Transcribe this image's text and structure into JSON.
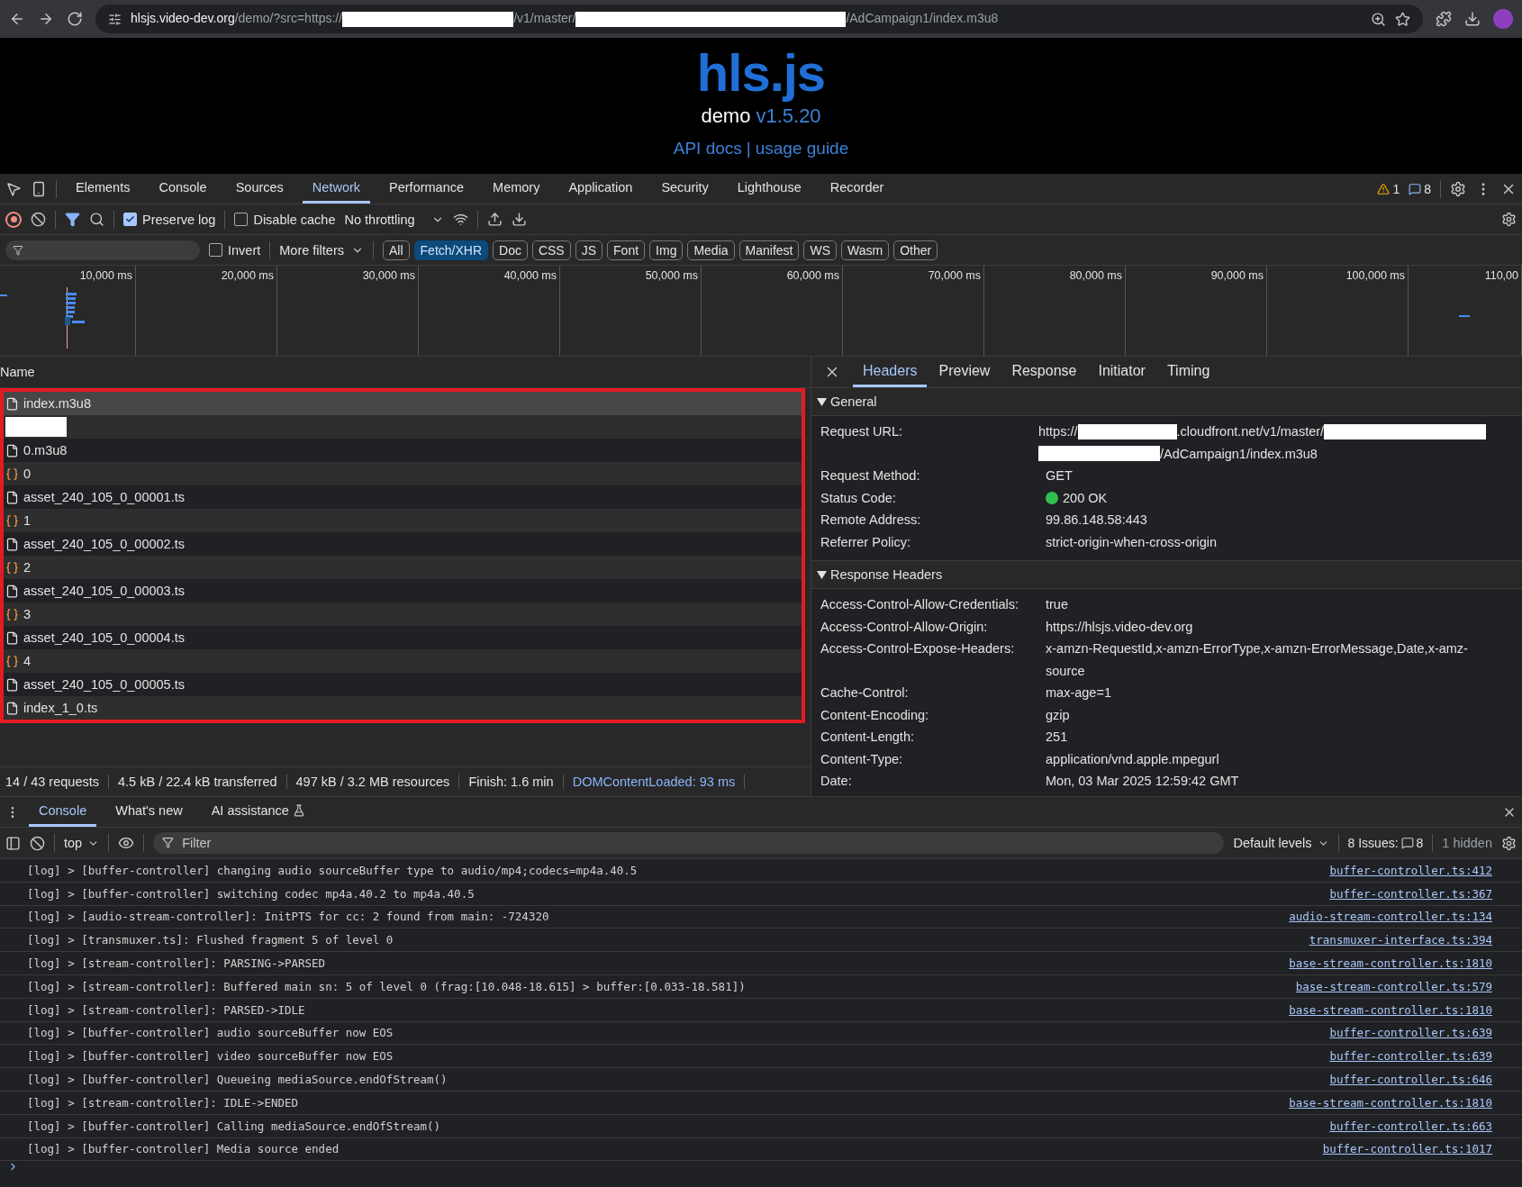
{
  "browser": {
    "url": [
      {
        "kind": "host",
        "text": "hlsjs.video-dev.org"
      },
      {
        "kind": "path",
        "text": "/demo/?src=https://"
      },
      {
        "kind": "redacted"
      },
      {
        "kind": "path",
        "text": "/v1/master/"
      },
      {
        "kind": "redacted"
      },
      {
        "kind": "path",
        "text": "/AdCampaign1/index.m3u8"
      }
    ]
  },
  "page": {
    "logo": "hls.js",
    "demo_label": "demo",
    "version": "v1.5.20",
    "links": [
      "API docs",
      "usage guide"
    ],
    "separator": "|"
  },
  "devtools": {
    "tabs": [
      {
        "label": "Elements",
        "selected": false
      },
      {
        "label": "Console",
        "selected": false
      },
      {
        "label": "Sources",
        "selected": false
      },
      {
        "label": "Network",
        "selected": true
      },
      {
        "label": "Performance",
        "selected": false
      },
      {
        "label": "Memory",
        "selected": false
      },
      {
        "label": "Application",
        "selected": false
      },
      {
        "label": "Security",
        "selected": false
      },
      {
        "label": "Lighthouse",
        "selected": false
      },
      {
        "label": "Recorder",
        "selected": false
      }
    ],
    "warnings": "1",
    "messages": "8"
  },
  "network_toolbar": {
    "recording": true,
    "preserve_log": {
      "label": "Preserve log",
      "checked": true
    },
    "disable_cache": {
      "label": "Disable cache",
      "checked": false
    },
    "throttling": "No throttling"
  },
  "filter_bar": {
    "invert": {
      "label": "Invert",
      "checked": false
    },
    "more_filters": "More filters",
    "types": [
      {
        "label": "All",
        "selected": false
      },
      {
        "label": "Fetch/XHR",
        "selected": true
      },
      {
        "label": "Doc",
        "selected": false
      },
      {
        "label": "CSS",
        "selected": false
      },
      {
        "label": "JS",
        "selected": false
      },
      {
        "label": "Font",
        "selected": false
      },
      {
        "label": "Img",
        "selected": false
      },
      {
        "label": "Media",
        "selected": false
      },
      {
        "label": "Manifest",
        "selected": false
      },
      {
        "label": "WS",
        "selected": false
      },
      {
        "label": "Wasm",
        "selected": false
      },
      {
        "label": "Other",
        "selected": false
      }
    ]
  },
  "timeline": {
    "ticks": [
      "10,000 ms",
      "20,000 ms",
      "30,000 ms",
      "40,000 ms",
      "50,000 ms",
      "60,000 ms",
      "70,000 ms",
      "80,000 ms",
      "90,000 ms",
      "100,000 ms",
      "110,00"
    ]
  },
  "requests": {
    "header": "Name",
    "rows": [
      {
        "kind": "doc",
        "name": "index.m3u8",
        "selected": true
      },
      {
        "kind": "redacted",
        "selected": false
      },
      {
        "kind": "doc",
        "name": "0.m3u8",
        "selected": false
      },
      {
        "kind": "xhr",
        "name": "0",
        "selected": false
      },
      {
        "kind": "doc",
        "name": "asset_240_105_0_00001.ts",
        "selected": false
      },
      {
        "kind": "xhr",
        "name": "1",
        "selected": false
      },
      {
        "kind": "doc",
        "name": "asset_240_105_0_00002.ts",
        "selected": false
      },
      {
        "kind": "xhr",
        "name": "2",
        "selected": false
      },
      {
        "kind": "doc",
        "name": "asset_240_105_0_00003.ts",
        "selected": false
      },
      {
        "kind": "xhr",
        "name": "3",
        "selected": false
      },
      {
        "kind": "doc",
        "name": "asset_240_105_0_00004.ts",
        "selected": false
      },
      {
        "kind": "xhr",
        "name": "4",
        "selected": false
      },
      {
        "kind": "doc",
        "name": "asset_240_105_0_00005.ts",
        "selected": false
      },
      {
        "kind": "doc",
        "name": "index_1_0.ts",
        "selected": false
      }
    ]
  },
  "details": {
    "tabs": [
      {
        "label": "Headers",
        "selected": true
      },
      {
        "label": "Preview",
        "selected": false
      },
      {
        "label": "Response",
        "selected": false
      },
      {
        "label": "Initiator",
        "selected": false
      },
      {
        "label": "Timing",
        "selected": false
      }
    ],
    "sections": [
      {
        "title": "General",
        "expanded": true,
        "fields": [
          {
            "label": "Request URL:",
            "kind": "segments",
            "segments": [
              {
                "kind": "text",
                "text": "https://"
              },
              {
                "kind": "redacted"
              },
              {
                "kind": "text",
                "text": ".cloudfront.net/v1/master/"
              },
              {
                "kind": "redacted"
              },
              {
                "kind": "redacted"
              },
              {
                "kind": "text",
                "text": "/AdCampaign1/index.m3u8"
              }
            ]
          },
          {
            "label": "Request Method:",
            "kind": "text",
            "value": "GET"
          },
          {
            "label": "Status Code:",
            "kind": "status",
            "value": "200 OK",
            "color": "#2fbf4f"
          },
          {
            "label": "Remote Address:",
            "kind": "text",
            "value": "99.86.148.58:443"
          },
          {
            "label": "Referrer Policy:",
            "kind": "text",
            "value": "strict-origin-when-cross-origin"
          }
        ]
      },
      {
        "title": "Response Headers",
        "expanded": true,
        "fields": [
          {
            "label": "Access-Control-Allow-Credentials:",
            "kind": "text",
            "value": "true"
          },
          {
            "label": "Access-Control-Allow-Origin:",
            "kind": "text",
            "value": "https://hlsjs.video-dev.org"
          },
          {
            "label": "Access-Control-Expose-Headers:",
            "kind": "text",
            "value": "x-amzn-RequestId,x-amzn-ErrorType,x-amzn-ErrorMessage,Date,x-amz-source"
          },
          {
            "label": "Cache-Control:",
            "kind": "text",
            "value": "max-age=1"
          },
          {
            "label": "Content-Encoding:",
            "kind": "text",
            "value": "gzip"
          },
          {
            "label": "Content-Length:",
            "kind": "text",
            "value": "251"
          },
          {
            "label": "Content-Type:",
            "kind": "text",
            "value": "application/vnd.apple.mpegurl"
          },
          {
            "label": "Date:",
            "kind": "text",
            "value": "Mon, 03 Mar 2025 12:59:42 GMT"
          }
        ]
      }
    ]
  },
  "status_bar": {
    "items": [
      "14 / 43 requests",
      "4.5 kB / 22.4 kB transferred",
      "497 kB / 3.2 MB resources",
      "Finish: 1.6 min"
    ],
    "dom_content_loaded": "DOMContentLoaded: 93 ms"
  },
  "console": {
    "tabs": [
      {
        "label": "Console",
        "selected": true,
        "kind": "plain"
      },
      {
        "label": "What's new",
        "selected": false,
        "kind": "plain"
      },
      {
        "label": "AI assistance",
        "selected": false,
        "kind": "experimental"
      }
    ],
    "context": "top",
    "filter_placeholder": "Filter",
    "levels": "Default levels",
    "issues_label": "8 Issues:",
    "issues_count": "8",
    "hidden": "1 hidden",
    "logs": [
      {
        "text": "[log] > [buffer-controller] changing audio sourceBuffer type to audio/mp4;codecs=mp4a.40.5",
        "source": "buffer-controller.ts:412"
      },
      {
        "text": "[log] > [buffer-controller] switching codec mp4a.40.2 to mp4a.40.5",
        "source": "buffer-controller.ts:367"
      },
      {
        "text": "[log] > [audio-stream-controller]: InitPTS for cc: 2 found from main: -724320",
        "source": "audio-stream-controller.ts:134"
      },
      {
        "text": "[log] > [transmuxer.ts]: Flushed fragment 5 of level 0",
        "source": "transmuxer-interface.ts:394"
      },
      {
        "text": "[log] > [stream-controller]: PARSING->PARSED",
        "source": "base-stream-controller.ts:1810"
      },
      {
        "text": "[log] > [stream-controller]: Buffered main sn: 5 of level 0 (frag:[10.048-18.615] > buffer:[0.033-18.581])",
        "source": "base-stream-controller.ts:579"
      },
      {
        "text": "[log] > [stream-controller]: PARSED->IDLE",
        "source": "base-stream-controller.ts:1810"
      },
      {
        "text": "[log] > [buffer-controller] audio sourceBuffer now EOS",
        "source": "buffer-controller.ts:639"
      },
      {
        "text": "[log] > [buffer-controller] video sourceBuffer now EOS",
        "source": "buffer-controller.ts:639"
      },
      {
        "text": "[log] > [buffer-controller] Queueing mediaSource.endOfStream()",
        "source": "buffer-controller.ts:646"
      },
      {
        "text": "[log] > [stream-controller]: IDLE->ENDED",
        "source": "base-stream-controller.ts:1810"
      },
      {
        "text": "[log] > [buffer-controller] Calling mediaSource.endOfStream()",
        "source": "buffer-controller.ts:663"
      },
      {
        "text": "[log] > [buffer-controller] Media source ended",
        "source": "buffer-controller.ts:1017"
      }
    ]
  }
}
